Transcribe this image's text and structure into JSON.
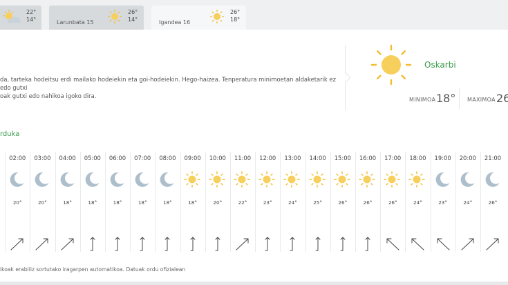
{
  "tabs": [
    {
      "label": "",
      "high": "22°",
      "low": "14°",
      "icon": "partly-cloudy-icon"
    },
    {
      "label": "Larunbata 15",
      "high": "26°",
      "low": "14°",
      "icon": "sun-icon"
    },
    {
      "label": "Igandea 16",
      "high": "26°",
      "low": "18°",
      "icon": "sun-icon"
    }
  ],
  "summary": {
    "description_line1": "da, tarteka hodeitsu erdi mailako hodeiekin eta goi-hodeiekin. Hego-haizea. Tenperatura minimoetan aldaketarik ez edo gutxi",
    "description_line2": "oak gutxi edo nahikoa igoko dira.",
    "condition": "Oskarbi",
    "min_label": "MINIMOA",
    "min_value": "18°",
    "max_label": "MAXIMOA",
    "max_value": "26"
  },
  "hourly": {
    "heading": "rduka",
    "hours": [
      {
        "time": "",
        "icon": "moon-icon",
        "temp": "",
        "wind": "ne"
      },
      {
        "time": "02:00",
        "icon": "moon-icon",
        "temp": "20°",
        "wind": "ne"
      },
      {
        "time": "03:00",
        "icon": "moon-icon",
        "temp": "20°",
        "wind": "ne"
      },
      {
        "time": "04:00",
        "icon": "moon-icon",
        "temp": "18°",
        "wind": "ne"
      },
      {
        "time": "05:00",
        "icon": "moon-icon",
        "temp": "18°",
        "wind": "n"
      },
      {
        "time": "06:00",
        "icon": "moon-icon",
        "temp": "18°",
        "wind": "n"
      },
      {
        "time": "07:00",
        "icon": "moon-icon",
        "temp": "18°",
        "wind": "n"
      },
      {
        "time": "08:00",
        "icon": "moon-icon",
        "temp": "18°",
        "wind": "n"
      },
      {
        "time": "09:00",
        "icon": "sun-icon",
        "temp": "18°",
        "wind": "n"
      },
      {
        "time": "10:00",
        "icon": "sun-icon",
        "temp": "20°",
        "wind": "n"
      },
      {
        "time": "11:00",
        "icon": "sun-icon",
        "temp": "22°",
        "wind": "ne"
      },
      {
        "time": "12:00",
        "icon": "sun-icon",
        "temp": "23°",
        "wind": "n"
      },
      {
        "time": "13:00",
        "icon": "sun-icon",
        "temp": "24°",
        "wind": "n"
      },
      {
        "time": "14:00",
        "icon": "sun-icon",
        "temp": "25°",
        "wind": "n"
      },
      {
        "time": "15:00",
        "icon": "sun-icon",
        "temp": "26°",
        "wind": "n"
      },
      {
        "time": "16:00",
        "icon": "sun-icon",
        "temp": "26°",
        "wind": "n"
      },
      {
        "time": "17:00",
        "icon": "sun-icon",
        "temp": "26°",
        "wind": "nw"
      },
      {
        "time": "18:00",
        "icon": "sun-icon",
        "temp": "24°",
        "wind": "nw"
      },
      {
        "time": "19:00",
        "icon": "moon-icon",
        "temp": "23°",
        "wind": "nw"
      },
      {
        "time": "20:00",
        "icon": "moon-icon",
        "temp": "24°",
        "wind": "ne"
      },
      {
        "time": "21:00",
        "icon": "moon-icon",
        "temp": "26°",
        "wind": "ne"
      }
    ]
  },
  "footer": {
    "note": "ikoak erabiliz sortutako iragarpen automatikoa. Datuak ordu ofizialean"
  },
  "colors": {
    "accent_green": "#3a9a4a",
    "sun_fill": "#f7cf5c",
    "sun_ray": "#f3bb2d",
    "moon_fill": "#aebfcc"
  }
}
